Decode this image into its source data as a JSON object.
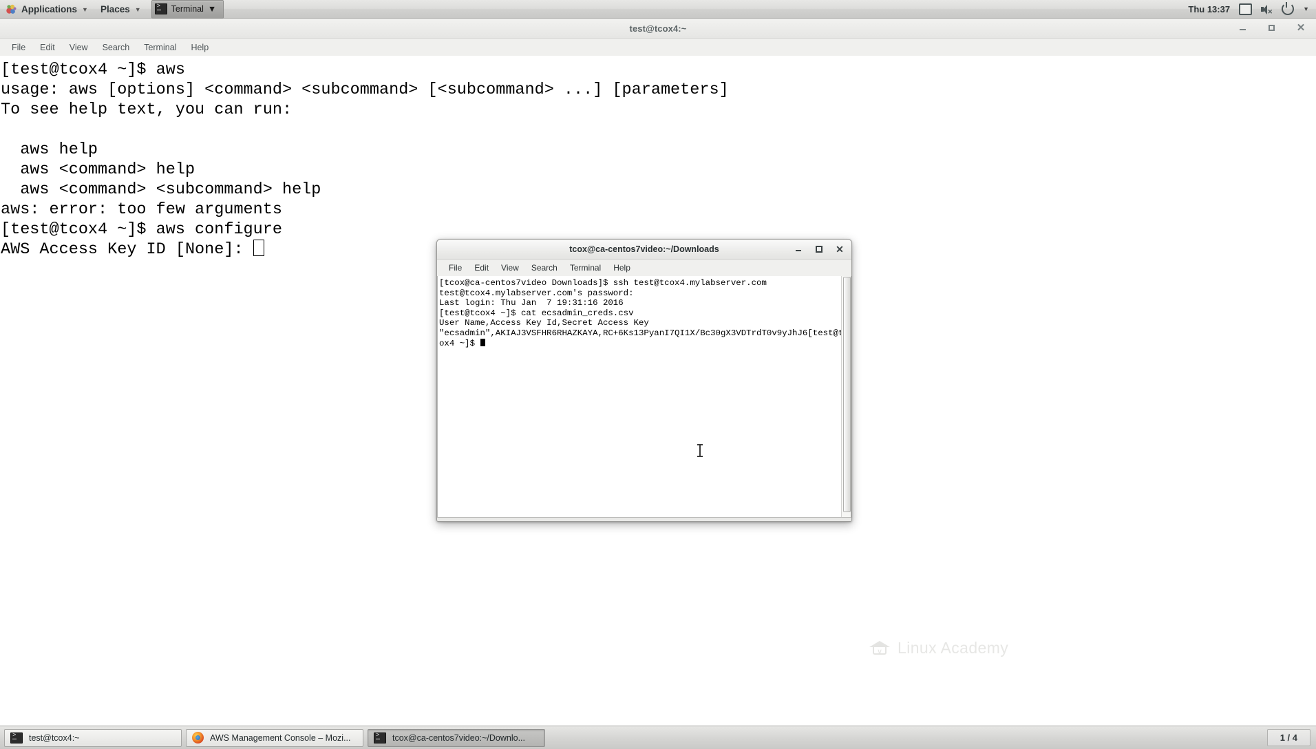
{
  "top_panel": {
    "applications_label": "Applications",
    "places_label": "Places",
    "window_task_label": "Terminal",
    "clock": "Thu 13:37",
    "icons": {
      "gnome_foot": "gnome-foot-icon",
      "display": "display-icon",
      "volume_muted": "volume-muted-icon",
      "power": "power-icon",
      "caret": "chevron-down-icon"
    }
  },
  "main_window": {
    "title": "test@tcox4:~",
    "menu": [
      "File",
      "Edit",
      "View",
      "Search",
      "Terminal",
      "Help"
    ],
    "controls": {
      "minimize": "–",
      "maximize": "□",
      "close": "×"
    },
    "terminal_lines": [
      "[test@tcox4 ~]$ aws",
      "usage: aws [options] <command> <subcommand> [<subcommand> ...] [parameters]",
      "To see help text, you can run:",
      "",
      "  aws help",
      "  aws <command> help",
      "  aws <command> <subcommand> help",
      "aws: error: too few arguments",
      "[test@tcox4 ~]$ aws configure",
      "AWS Access Key ID [None]: "
    ]
  },
  "second_window": {
    "title": "tcox@ca-centos7video:~/Downloads",
    "menu": [
      "File",
      "Edit",
      "View",
      "Search",
      "Terminal",
      "Help"
    ],
    "controls": {
      "minimize": "–",
      "maximize": "□",
      "close": "×"
    },
    "terminal_lines": [
      "[tcox@ca-centos7video Downloads]$ ssh test@tcox4.mylabserver.com",
      "test@tcox4.mylabserver.com's password:",
      "Last login: Thu Jan  7 19:31:16 2016",
      "[test@tcox4 ~]$ cat ecsadmin_creds.csv",
      "User Name,Access Key Id,Secret Access Key",
      "\"ecsadmin\",AKIAJ3VSFHR6RHAZKAYA,RC+6Ks13PyanI7QI1X/Bc30gX3VDTrdT0v9yJhJ6[test@tc",
      "ox4 ~]$ "
    ]
  },
  "watermark": {
    "text": "Linux Academy",
    "icon": "graduation-cap-icon"
  },
  "taskbar": {
    "items": [
      {
        "label": "test@tcox4:~",
        "icon": "terminal-icon",
        "active": false
      },
      {
        "label": "AWS Management Console – Mozi...",
        "icon": "firefox-icon",
        "active": false
      },
      {
        "label": "tcox@ca-centos7video:~/Downlo...",
        "icon": "terminal-icon",
        "active": true
      }
    ],
    "workspace": "1 / 4"
  },
  "colors": {
    "panel_bg": "#d8d8d6",
    "terminal_bg": "#ffffff",
    "terminal_fg": "#000000",
    "title_fg": "#5c6466"
  }
}
